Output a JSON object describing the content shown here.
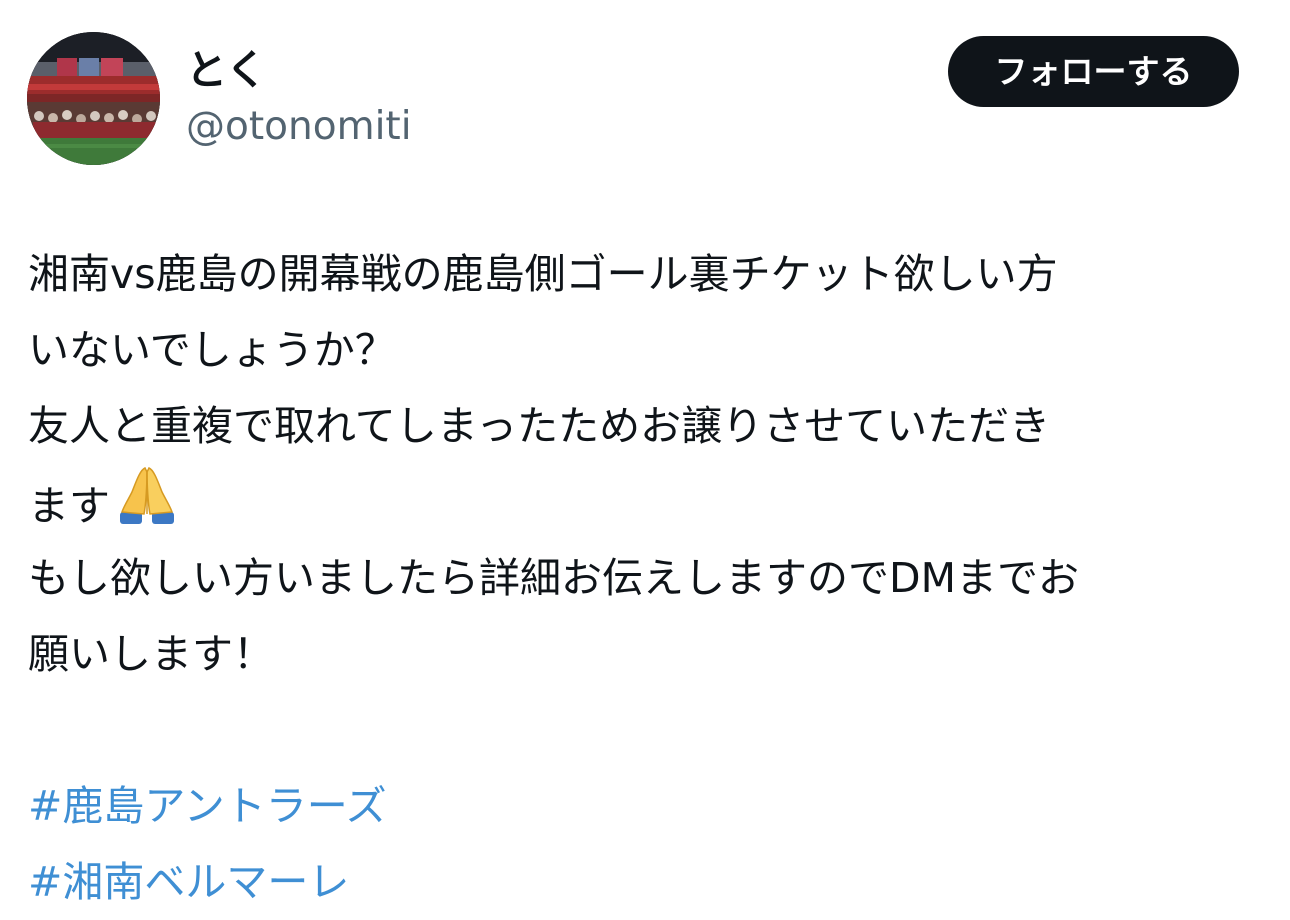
{
  "user": {
    "display_name": "とく",
    "handle": "@otonomiti",
    "avatar_icon": "stadium-photo-avatar"
  },
  "follow_button": {
    "label": "フォローする"
  },
  "tweet": {
    "lines": [
      "湘南vs鹿島の開幕戦の鹿島側ゴール裏チケット欲しい方",
      "いないでしょうか？",
      "友人と重複で取れてしまったためお譲りさせていただき",
      "ます",
      "もし欲しい方いましたら詳細お伝えしますのでDMまでお",
      "願いします！"
    ],
    "emoji_icon": "folded-hands-icon",
    "hashtags": [
      "#鹿島アントラーズ",
      "#湘南ベルマーレ"
    ]
  },
  "colors": {
    "text": "#0f1419",
    "secondary": "#536471",
    "link": "#3f8fd4",
    "button_bg": "#0f1419",
    "button_text": "#ffffff"
  }
}
